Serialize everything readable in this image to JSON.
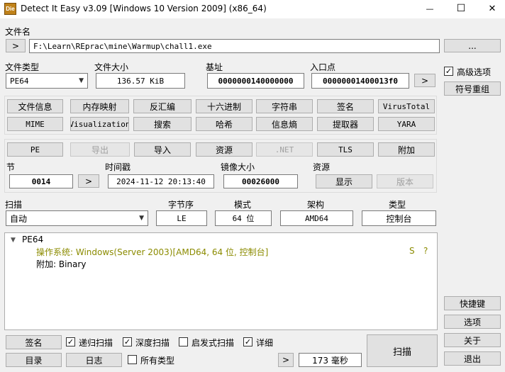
{
  "window": {
    "title": "Detect It Easy v3.09 [Windows 10 Version 2009] (x86_64)",
    "logo_text": "Die",
    "minimize_glyph": "—",
    "maximize_glyph": "☐",
    "close_glyph": "✕"
  },
  "file": {
    "label": "文件名",
    "browse_glyph": ">",
    "path": "F:\\Learn\\REprac\\mine\\Warmup\\chall1.exe",
    "more_label": "..."
  },
  "info": {
    "type_label": "文件类型",
    "type_value": "PE64",
    "size_label": "文件大小",
    "size_value": "136.57 KiB",
    "base_label": "基址",
    "base_value": "0000000140000000",
    "entry_label": "入口点",
    "entry_value": "00000001400013f0",
    "entry_btn": ">"
  },
  "right": {
    "advanced_label": "高级选项",
    "advanced_checked": "✓",
    "reorg_label": "符号重组"
  },
  "tools_row1": [
    "文件信息",
    "内存映射",
    "反汇编",
    "十六进制",
    "字符串",
    "签名",
    "VirusTotal"
  ],
  "tools_row2": [
    "MIME",
    "Visualization",
    "搜索",
    "哈希",
    "信息熵",
    "提取器",
    "YARA"
  ],
  "pe_row": [
    "PE",
    "导出",
    "导入",
    "资源",
    ".NET",
    "TLS",
    "附加"
  ],
  "section": {
    "sec_label": "节",
    "sec_value": "0014",
    "sec_btn": ">",
    "time_label": "时间戳",
    "time_value": "2024-11-12 20:13:40",
    "image_label": "镜像大小",
    "image_value": "00026000",
    "res_label": "资源",
    "show_label": "显示",
    "version_label": "版本"
  },
  "scan": {
    "scan_label": "扫描",
    "scan_value": "自动",
    "endian_label": "字节序",
    "endian_value": "LE",
    "mode_label": "模式",
    "mode_value": "64 位",
    "arch_label": "架构",
    "arch_value": "AMD64",
    "type_label": "类型",
    "type_value": "控制台"
  },
  "results": {
    "root": "PE64",
    "root_toggle": "▼",
    "os_line": "操作系统: Windows(Server 2003)[AMD64, 64 位, 控制台]",
    "os_s": "S",
    "os_q": "?",
    "overlay_line": "附加: Binary"
  },
  "side_buttons": [
    "快捷键",
    "选项",
    "关于",
    "退出"
  ],
  "bottom": {
    "sign_label": "签名",
    "recursive_label": "递归扫描",
    "deep_label": "深度扫描",
    "heuristic_label": "启发式扫描",
    "verbose_label": "详细",
    "dir_label": "目录",
    "log_label": "日志",
    "alltypes_label": "所有类型",
    "time_btn": ">",
    "elapsed": "173 毫秒",
    "scan_btn": "扫描",
    "check_mark": "✓"
  },
  "colors": {
    "accent_text": "#8b8b00",
    "window_bg": "#f0f0f0"
  }
}
